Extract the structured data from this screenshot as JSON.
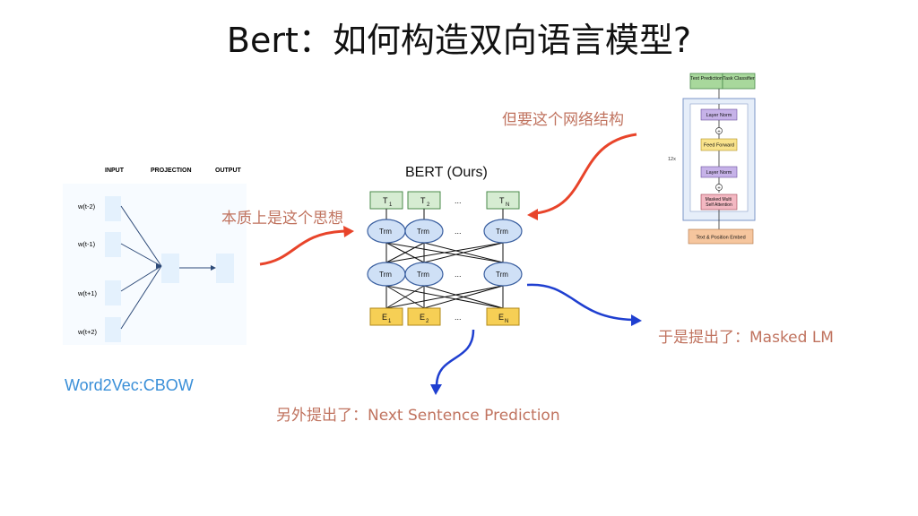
{
  "slide": {
    "title": "Bert：如何构造双向语言模型?"
  },
  "cbow": {
    "headers": {
      "input": "INPUT",
      "projection": "PROJECTION",
      "output": "OUTPUT"
    },
    "inputs": [
      "w(t-2)",
      "w(t-1)",
      "w(t+1)",
      "w(t+2)"
    ],
    "caption": "Word2Vec:CBOW"
  },
  "bert": {
    "title": "BERT (Ours)",
    "output_tokens": [
      "T",
      "T",
      "...",
      "T"
    ],
    "output_subs": [
      "1",
      "2",
      "",
      "N"
    ],
    "trm_label": "Trm",
    "ellipsis": "...",
    "input_tokens": [
      "E",
      "E",
      "...",
      "E"
    ],
    "input_subs": [
      "1",
      "2",
      "",
      "N"
    ]
  },
  "transformer": {
    "outputs": [
      "Text Prediction",
      "Task Classifier"
    ],
    "layer_norm": "Layer Norm",
    "feed_forward": "Feed Forward",
    "attention": "Masked Multi Self Attention",
    "repeat": "12x",
    "embed": "Text & Position Embed",
    "plus": "+"
  },
  "annotations": {
    "essence": "本质上是这个思想",
    "structure": "但要这个网络结构",
    "masked_lm": "于是提出了：Masked LM",
    "nsp": "另外提出了：Next Sentence Prediction"
  },
  "colors": {
    "red_arrow": "#e8442a",
    "blue_arrow": "#1f3fd0",
    "trm_fill": "#cfe0f6",
    "token_out": "#d6ecd2",
    "token_in": "#f6cf55",
    "cbow_box": "#e4f1fd"
  }
}
